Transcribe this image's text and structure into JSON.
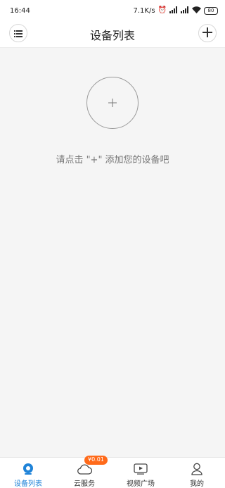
{
  "status_bar": {
    "time": "16:44",
    "net_speed": "7.1K/s",
    "battery": "80",
    "icons": [
      "alarm-icon",
      "signal-icon",
      "signal-icon",
      "wifi-icon",
      "battery-icon"
    ]
  },
  "header": {
    "title": "设备列表",
    "menu_icon": "list-icon",
    "add_icon": "plus-icon"
  },
  "main": {
    "add_icon": "plus-icon",
    "hint": "请点击 \"+\" 添加您的设备吧"
  },
  "tabbar": {
    "tabs": [
      {
        "label": "设备列表",
        "icon": "device-list-icon",
        "active": true
      },
      {
        "label": "云服务",
        "icon": "cloud-icon",
        "badge": "¥0.01"
      },
      {
        "label": "视频广场",
        "icon": "video-play-icon"
      },
      {
        "label": "我的",
        "icon": "user-icon"
      }
    ]
  },
  "colors": {
    "accent": "#1f83d8",
    "badge": "#ff6a1a",
    "background": "#f5f5f5"
  }
}
